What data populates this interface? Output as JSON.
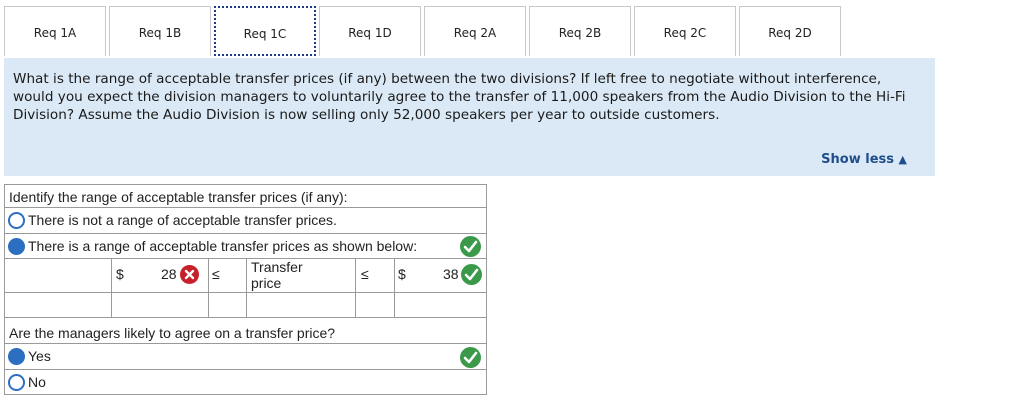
{
  "tabs": [
    {
      "label": "Req 1A"
    },
    {
      "label": "Req 1B"
    },
    {
      "label": "Req 1C"
    },
    {
      "label": "Req 1D"
    },
    {
      "label": "Req 2A"
    },
    {
      "label": "Req 2B"
    },
    {
      "label": "Req 2C"
    },
    {
      "label": "Req 2D"
    }
  ],
  "active_tab": "Req 1C",
  "question": {
    "text": "What is the range of acceptable transfer prices (if any) between the two divisions? If left free to negotiate without interference, would you expect the division managers to voluntarily agree to the transfer of 11,000 speakers from the Audio Division to the Hi-Fi Division? Assume the Audio Division is now selling only 52,000 speakers per year to outside customers.",
    "show_less": "Show less"
  },
  "answer": {
    "identify_label": "Identify the range of acceptable transfer prices (if any):",
    "option_none": "There is not a range of acceptable transfer prices.",
    "option_range": "There is a range of acceptable transfer prices as shown below:",
    "range": {
      "low_currency": "$",
      "low_value": "28",
      "leq1": "≤",
      "middle_label": "Transfer price",
      "leq2": "≤",
      "high_currency": "$",
      "high_value": "38"
    },
    "agree_question": "Are the managers likely to agree on a transfer price?",
    "option_yes": "Yes",
    "option_no": "No"
  },
  "colors": {
    "check": "#3a9a4a",
    "error": "#c8202a",
    "radio": "#2c6fc1",
    "panel": "#dbe9f6"
  }
}
